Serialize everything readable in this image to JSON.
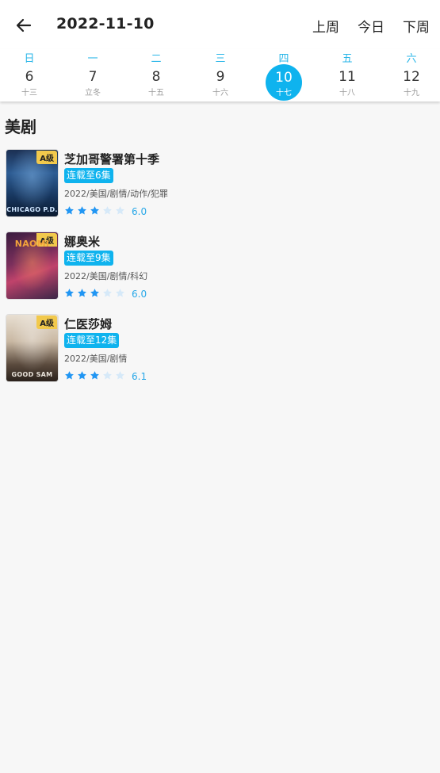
{
  "header": {
    "title": "2022-11-10",
    "prev_week": "上周",
    "today": "今日",
    "next_week": "下周"
  },
  "calendar": {
    "days": [
      {
        "weekday": "日",
        "day": "6",
        "lunar": "十三"
      },
      {
        "weekday": "一",
        "day": "7",
        "lunar": "立冬"
      },
      {
        "weekday": "二",
        "day": "8",
        "lunar": "十五"
      },
      {
        "weekday": "三",
        "day": "9",
        "lunar": "十六"
      },
      {
        "weekday": "四",
        "day": "10",
        "lunar": "十七"
      },
      {
        "weekday": "五",
        "day": "11",
        "lunar": "十八"
      },
      {
        "weekday": "六",
        "day": "12",
        "lunar": "十九"
      }
    ],
    "selected_index": 4
  },
  "section": {
    "title": "美剧"
  },
  "shows": [
    {
      "name": "芝加哥警署第十季",
      "grade": "A级",
      "episode": "连载至6集",
      "meta": "2022/美国/剧情/动作/犯罪",
      "score": "6.0",
      "stars": 3,
      "poster_caption": "CHICAGO P.D."
    },
    {
      "name": "娜奥米",
      "grade": "A级",
      "episode": "连载至9集",
      "meta": "2022/美国/剧情/科幻",
      "score": "6.0",
      "stars": 3,
      "poster_caption": "NAOMI"
    },
    {
      "name": "仁医莎姆",
      "grade": "A级",
      "episode": "连载至12集",
      "meta": "2022/美国/剧情",
      "score": "6.1",
      "stars": 3,
      "poster_caption": "GOOD SAM"
    }
  ],
  "colors": {
    "accent": "#0fb3ee",
    "star_on": "#2196f3",
    "star_off": "#d6e9f8"
  }
}
